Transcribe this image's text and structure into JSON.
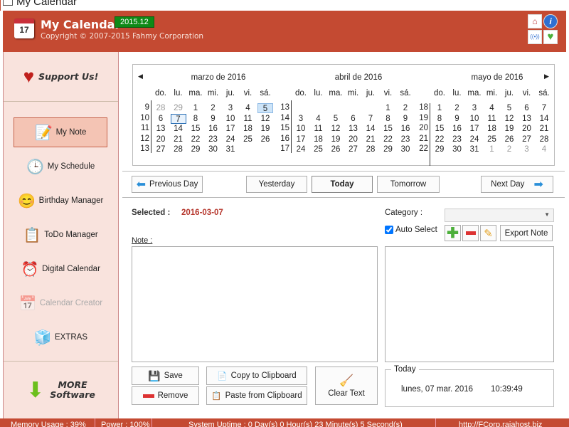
{
  "window": {
    "title": "My Calendar"
  },
  "header": {
    "app_title": "My Calendar",
    "version": "2015.12",
    "copyright": "Copyright © 2007-2015 Fahmy Corporation",
    "icon_day": "17",
    "buttons": [
      {
        "name": "home-icon",
        "glyph": "⌂"
      },
      {
        "name": "info-icon",
        "glyph": "i"
      },
      {
        "name": "broadcast-icon",
        "glyph": "((•))"
      },
      {
        "name": "heart-plus-icon",
        "glyph": "♥"
      }
    ]
  },
  "sidebar": {
    "support": "Support Us!",
    "more": [
      "MORE",
      "Software"
    ],
    "items": [
      {
        "label": "My Note",
        "icon": "notebook-icon",
        "glyph": "📝",
        "active": true
      },
      {
        "label": "My Schedule",
        "icon": "clock-icon",
        "glyph": "🕒"
      },
      {
        "label": "Birthday Manager",
        "icon": "smiley-users-icon",
        "glyph": "😊"
      },
      {
        "label": "ToDo Manager",
        "icon": "todo-list-icon",
        "glyph": "📋"
      },
      {
        "label": "Digital Calendar",
        "icon": "digital-clock-icon",
        "glyph": "⏰"
      },
      {
        "label": "Calendar Creator",
        "icon": "calendar-icon",
        "glyph": "📅",
        "disabled": true
      },
      {
        "label": "EXTRAS",
        "icon": "cubes-icon",
        "glyph": "🧊"
      }
    ]
  },
  "calendar": {
    "day_headers": [
      "do.",
      "lu.",
      "ma.",
      "mi.",
      "ju.",
      "vi.",
      "sá."
    ],
    "months": [
      {
        "title": "marzo de 2016",
        "weeks": [
          {
            "num": "9",
            "days": [
              {
                "d": "28",
                "m": 1
              },
              {
                "d": "29",
                "m": 1
              },
              {
                "d": "1"
              },
              {
                "d": "2"
              },
              {
                "d": "3"
              },
              {
                "d": "4"
              },
              {
                "d": "5",
                "today": 1
              }
            ]
          },
          {
            "num": "10",
            "days": [
              {
                "d": "6"
              },
              {
                "d": "7",
                "sel": 1
              },
              {
                "d": "8"
              },
              {
                "d": "9"
              },
              {
                "d": "10"
              },
              {
                "d": "11"
              },
              {
                "d": "12"
              }
            ]
          },
          {
            "num": "11",
            "days": [
              {
                "d": "13"
              },
              {
                "d": "14"
              },
              {
                "d": "15"
              },
              {
                "d": "16"
              },
              {
                "d": "17"
              },
              {
                "d": "18"
              },
              {
                "d": "19"
              }
            ]
          },
          {
            "num": "12",
            "days": [
              {
                "d": "20"
              },
              {
                "d": "21"
              },
              {
                "d": "22"
              },
              {
                "d": "23"
              },
              {
                "d": "24"
              },
              {
                "d": "25"
              },
              {
                "d": "26"
              }
            ]
          },
          {
            "num": "13",
            "days": [
              {
                "d": "27"
              },
              {
                "d": "28"
              },
              {
                "d": "29"
              },
              {
                "d": "30"
              },
              {
                "d": "31"
              },
              {
                "d": ""
              },
              {
                "d": ""
              }
            ]
          }
        ]
      },
      {
        "title": "abril de 2016",
        "weeks": [
          {
            "num": "13",
            "days": [
              {
                "d": ""
              },
              {
                "d": ""
              },
              {
                "d": ""
              },
              {
                "d": ""
              },
              {
                "d": ""
              },
              {
                "d": "1"
              },
              {
                "d": "2"
              }
            ]
          },
          {
            "num": "14",
            "days": [
              {
                "d": "3"
              },
              {
                "d": "4"
              },
              {
                "d": "5"
              },
              {
                "d": "6"
              },
              {
                "d": "7"
              },
              {
                "d": "8"
              },
              {
                "d": "9"
              }
            ]
          },
          {
            "num": "15",
            "days": [
              {
                "d": "10"
              },
              {
                "d": "11"
              },
              {
                "d": "12"
              },
              {
                "d": "13"
              },
              {
                "d": "14"
              },
              {
                "d": "15"
              },
              {
                "d": "16"
              }
            ]
          },
          {
            "num": "16",
            "days": [
              {
                "d": "17"
              },
              {
                "d": "18"
              },
              {
                "d": "19"
              },
              {
                "d": "20"
              },
              {
                "d": "21"
              },
              {
                "d": "22"
              },
              {
                "d": "23"
              }
            ]
          },
          {
            "num": "17",
            "days": [
              {
                "d": "24"
              },
              {
                "d": "25"
              },
              {
                "d": "26"
              },
              {
                "d": "27"
              },
              {
                "d": "28"
              },
              {
                "d": "29"
              },
              {
                "d": "30"
              }
            ]
          }
        ]
      },
      {
        "title": "mayo de 2016",
        "weeks": [
          {
            "num": "",
            "days": [
              {
                "d": ""
              },
              {
                "d": ""
              },
              {
                "d": ""
              },
              {
                "d": ""
              },
              {
                "d": ""
              },
              {
                "d": ""
              },
              {
                "d": ""
              }
            ]
          },
          {
            "num": "18",
            "days": [
              {
                "d": "1"
              },
              {
                "d": "2"
              },
              {
                "d": "3"
              },
              {
                "d": "4"
              },
              {
                "d": "5"
              },
              {
                "d": "6"
              },
              {
                "d": "7"
              }
            ]
          },
          {
            "num": "19",
            "days": [
              {
                "d": "8"
              },
              {
                "d": "9"
              },
              {
                "d": "10"
              },
              {
                "d": "11"
              },
              {
                "d": "12"
              },
              {
                "d": "13"
              },
              {
                "d": "14"
              }
            ]
          },
          {
            "num": "20",
            "days": [
              {
                "d": "15"
              },
              {
                "d": "16"
              },
              {
                "d": "17"
              },
              {
                "d": "18"
              },
              {
                "d": "19"
              },
              {
                "d": "20"
              },
              {
                "d": "21"
              }
            ]
          },
          {
            "num": "21",
            "days": [
              {
                "d": "22"
              },
              {
                "d": "23"
              },
              {
                "d": "24"
              },
              {
                "d": "25"
              },
              {
                "d": "26"
              },
              {
                "d": "27"
              },
              {
                "d": "28"
              }
            ]
          },
          {
            "num": "22",
            "days": [
              {
                "d": "29"
              },
              {
                "d": "30"
              },
              {
                "d": "31"
              },
              {
                "d": "1",
                "m": 1
              },
              {
                "d": "2",
                "m": 1
              },
              {
                "d": "3",
                "m": 1
              },
              {
                "d": "4",
                "m": 1
              }
            ]
          }
        ]
      }
    ]
  },
  "nav": {
    "previous_day": "Previous Day",
    "yesterday": "Yesterday",
    "today": "Today",
    "tomorrow": "Tomorrow",
    "next_day": "Next Day"
  },
  "note": {
    "selected_label": "Selected :",
    "selected_value": "2016-03-07",
    "note_label": "Note :",
    "note_value": "",
    "category_label": "Category :",
    "category_value": "",
    "auto_select": "Auto Select",
    "auto_select_checked": true,
    "export": "Export Note"
  },
  "actions": {
    "save": "Save",
    "remove": "Remove",
    "copy": "Copy to Clipboard",
    "paste": "Paste from Clipboard",
    "clear": "Clear Text"
  },
  "today_box": {
    "label": "Today",
    "date": "lunes, 07 mar. 2016",
    "time": "10:39:49"
  },
  "status": {
    "memory": "Memory Usage : 39%",
    "power": "Power : 100%",
    "uptime": "System Uptime : 0 Day(s) 0 Hour(s) 23 Minute(s) 5 Second(s)",
    "url": "http://FCorp.rajahost.biz"
  },
  "colors": {
    "header": "#c44a32",
    "sidebar": "#f9e3dd",
    "selected_date": "#b5342a",
    "version_badge": "#0e8a17"
  }
}
